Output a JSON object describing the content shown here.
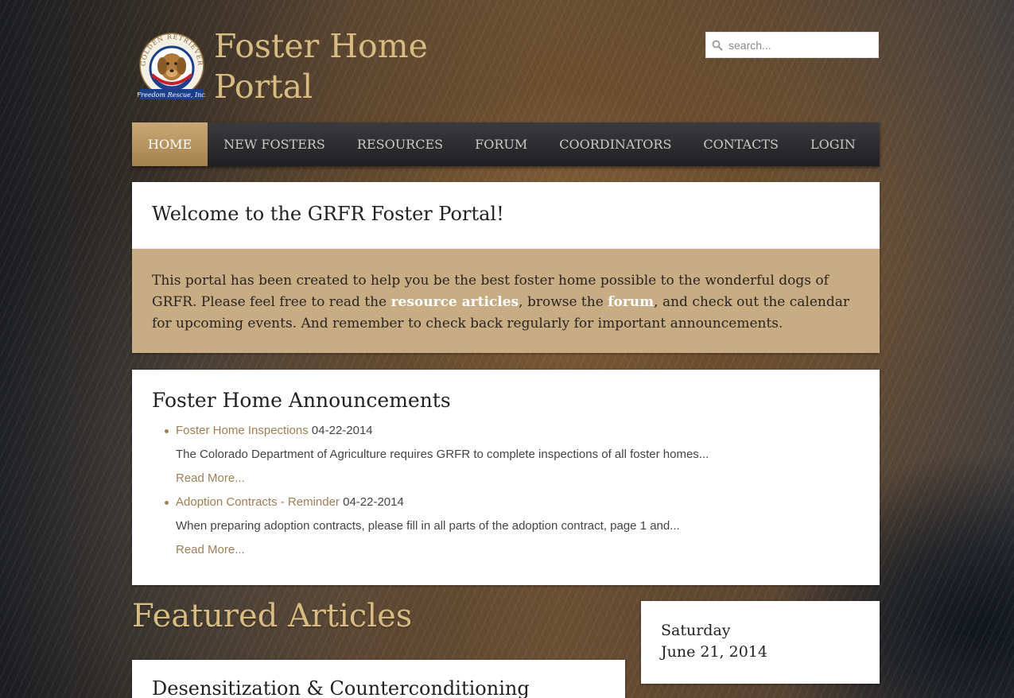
{
  "header": {
    "title": "Foster Home Portal",
    "logo_name": "golden-retriever-freedom-rescue-logo",
    "logo_text_top": "GOLDEN RETRIEVER",
    "logo_text_bottom": "Freedom Rescue, Inc."
  },
  "search": {
    "placeholder": "search..."
  },
  "nav": {
    "items": [
      {
        "label": "HOME",
        "active": true
      },
      {
        "label": "NEW FOSTERS"
      },
      {
        "label": "RESOURCES"
      },
      {
        "label": "FORUM"
      },
      {
        "label": "COORDINATORS"
      },
      {
        "label": "CONTACTS"
      },
      {
        "label": "LOGIN"
      }
    ]
  },
  "welcome": {
    "heading": "Welcome to the GRFR Foster Portal!"
  },
  "intro": {
    "part1": "This portal has been created to help you be the best foster home possible to the wonderful dogs of GRFR. Please feel free to read the ",
    "link1": "resource articles",
    "part2": ", browse the ",
    "link2": "forum",
    "part3": ", and check out the calendar for upcoming events. And remember to check back regularly for important announcements."
  },
  "announcements": {
    "heading": "Foster Home Announcements",
    "items": [
      {
        "title": "Foster Home Inspections",
        "date": "04-22-2014",
        "excerpt": "The Colorado Department of Agriculture requires GRFR to complete inspections of all foster homes...",
        "read_more": "Read More..."
      },
      {
        "title": "Adoption Contracts - Reminder",
        "date": "04-22-2014",
        "excerpt": "When preparing adoption contracts, please fill in all parts of the adoption contract, page 1 and...",
        "read_more": "Read More..."
      }
    ]
  },
  "featured": {
    "heading": "Featured Articles",
    "article_title": "Desensitization & Counterconditioning"
  },
  "calendar": {
    "day": "Saturday",
    "date": "June 21, 2014"
  },
  "colors": {
    "accent_gold": "#d7bb80",
    "intro_bg": "#c8ad84",
    "link_brown": "#a07e55",
    "nav_active": "#b89563"
  }
}
